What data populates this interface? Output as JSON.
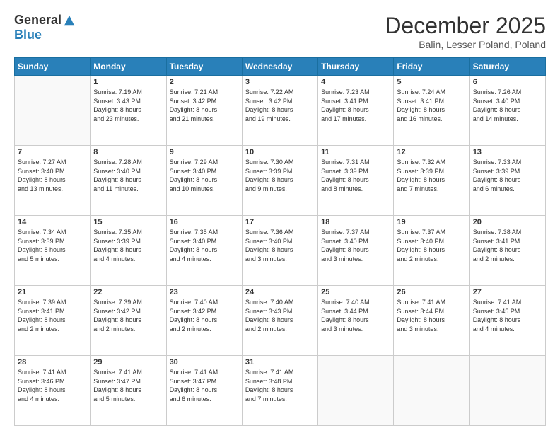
{
  "header": {
    "logo_general": "General",
    "logo_blue": "Blue",
    "month_title": "December 2025",
    "location": "Balin, Lesser Poland, Poland"
  },
  "days_of_week": [
    "Sunday",
    "Monday",
    "Tuesday",
    "Wednesday",
    "Thursday",
    "Friday",
    "Saturday"
  ],
  "weeks": [
    [
      {
        "day": "",
        "content": ""
      },
      {
        "day": "1",
        "content": "Sunrise: 7:19 AM\nSunset: 3:43 PM\nDaylight: 8 hours\nand 23 minutes."
      },
      {
        "day": "2",
        "content": "Sunrise: 7:21 AM\nSunset: 3:42 PM\nDaylight: 8 hours\nand 21 minutes."
      },
      {
        "day": "3",
        "content": "Sunrise: 7:22 AM\nSunset: 3:42 PM\nDaylight: 8 hours\nand 19 minutes."
      },
      {
        "day": "4",
        "content": "Sunrise: 7:23 AM\nSunset: 3:41 PM\nDaylight: 8 hours\nand 17 minutes."
      },
      {
        "day": "5",
        "content": "Sunrise: 7:24 AM\nSunset: 3:41 PM\nDaylight: 8 hours\nand 16 minutes."
      },
      {
        "day": "6",
        "content": "Sunrise: 7:26 AM\nSunset: 3:40 PM\nDaylight: 8 hours\nand 14 minutes."
      }
    ],
    [
      {
        "day": "7",
        "content": "Sunrise: 7:27 AM\nSunset: 3:40 PM\nDaylight: 8 hours\nand 13 minutes."
      },
      {
        "day": "8",
        "content": "Sunrise: 7:28 AM\nSunset: 3:40 PM\nDaylight: 8 hours\nand 11 minutes."
      },
      {
        "day": "9",
        "content": "Sunrise: 7:29 AM\nSunset: 3:40 PM\nDaylight: 8 hours\nand 10 minutes."
      },
      {
        "day": "10",
        "content": "Sunrise: 7:30 AM\nSunset: 3:39 PM\nDaylight: 8 hours\nand 9 minutes."
      },
      {
        "day": "11",
        "content": "Sunrise: 7:31 AM\nSunset: 3:39 PM\nDaylight: 8 hours\nand 8 minutes."
      },
      {
        "day": "12",
        "content": "Sunrise: 7:32 AM\nSunset: 3:39 PM\nDaylight: 8 hours\nand 7 minutes."
      },
      {
        "day": "13",
        "content": "Sunrise: 7:33 AM\nSunset: 3:39 PM\nDaylight: 8 hours\nand 6 minutes."
      }
    ],
    [
      {
        "day": "14",
        "content": "Sunrise: 7:34 AM\nSunset: 3:39 PM\nDaylight: 8 hours\nand 5 minutes."
      },
      {
        "day": "15",
        "content": "Sunrise: 7:35 AM\nSunset: 3:39 PM\nDaylight: 8 hours\nand 4 minutes."
      },
      {
        "day": "16",
        "content": "Sunrise: 7:35 AM\nSunset: 3:40 PM\nDaylight: 8 hours\nand 4 minutes."
      },
      {
        "day": "17",
        "content": "Sunrise: 7:36 AM\nSunset: 3:40 PM\nDaylight: 8 hours\nand 3 minutes."
      },
      {
        "day": "18",
        "content": "Sunrise: 7:37 AM\nSunset: 3:40 PM\nDaylight: 8 hours\nand 3 minutes."
      },
      {
        "day": "19",
        "content": "Sunrise: 7:37 AM\nSunset: 3:40 PM\nDaylight: 8 hours\nand 2 minutes."
      },
      {
        "day": "20",
        "content": "Sunrise: 7:38 AM\nSunset: 3:41 PM\nDaylight: 8 hours\nand 2 minutes."
      }
    ],
    [
      {
        "day": "21",
        "content": "Sunrise: 7:39 AM\nSunset: 3:41 PM\nDaylight: 8 hours\nand 2 minutes."
      },
      {
        "day": "22",
        "content": "Sunrise: 7:39 AM\nSunset: 3:42 PM\nDaylight: 8 hours\nand 2 minutes."
      },
      {
        "day": "23",
        "content": "Sunrise: 7:40 AM\nSunset: 3:42 PM\nDaylight: 8 hours\nand 2 minutes."
      },
      {
        "day": "24",
        "content": "Sunrise: 7:40 AM\nSunset: 3:43 PM\nDaylight: 8 hours\nand 2 minutes."
      },
      {
        "day": "25",
        "content": "Sunrise: 7:40 AM\nSunset: 3:44 PM\nDaylight: 8 hours\nand 3 minutes."
      },
      {
        "day": "26",
        "content": "Sunrise: 7:41 AM\nSunset: 3:44 PM\nDaylight: 8 hours\nand 3 minutes."
      },
      {
        "day": "27",
        "content": "Sunrise: 7:41 AM\nSunset: 3:45 PM\nDaylight: 8 hours\nand 4 minutes."
      }
    ],
    [
      {
        "day": "28",
        "content": "Sunrise: 7:41 AM\nSunset: 3:46 PM\nDaylight: 8 hours\nand 4 minutes."
      },
      {
        "day": "29",
        "content": "Sunrise: 7:41 AM\nSunset: 3:47 PM\nDaylight: 8 hours\nand 5 minutes."
      },
      {
        "day": "30",
        "content": "Sunrise: 7:41 AM\nSunset: 3:47 PM\nDaylight: 8 hours\nand 6 minutes."
      },
      {
        "day": "31",
        "content": "Sunrise: 7:41 AM\nSunset: 3:48 PM\nDaylight: 8 hours\nand 7 minutes."
      },
      {
        "day": "",
        "content": ""
      },
      {
        "day": "",
        "content": ""
      },
      {
        "day": "",
        "content": ""
      }
    ]
  ]
}
